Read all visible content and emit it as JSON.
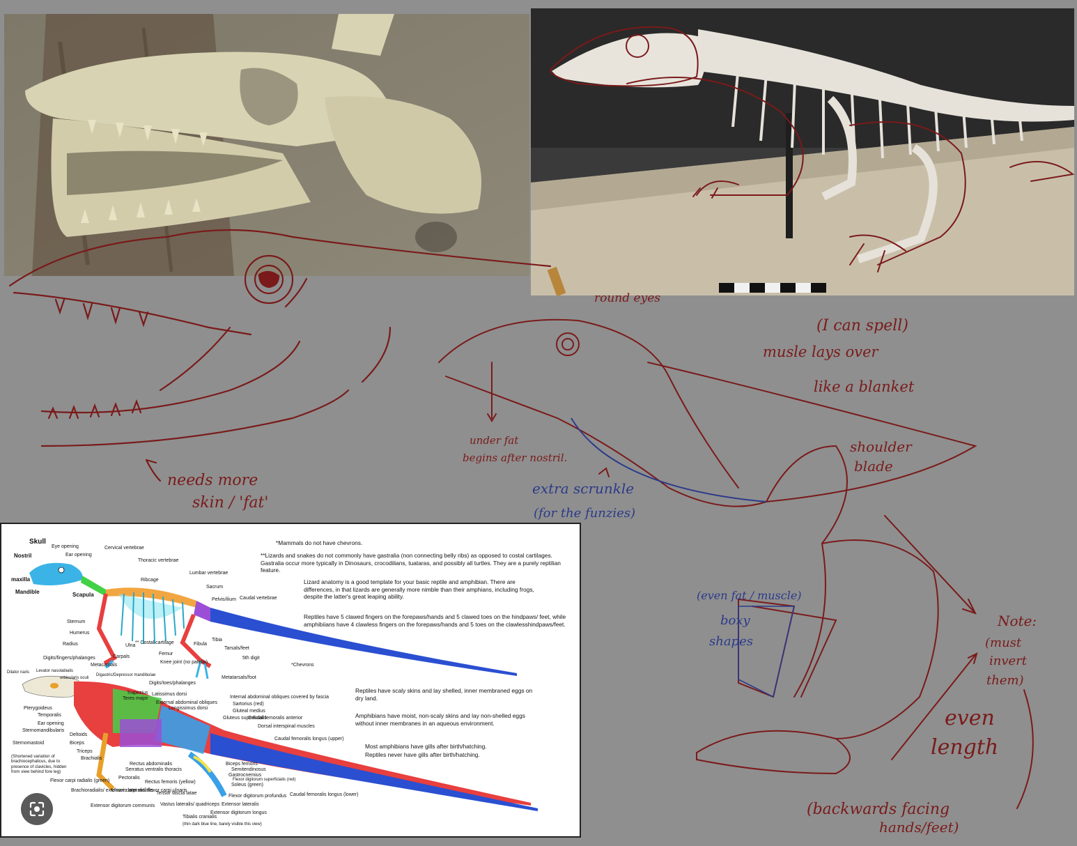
{
  "handwritten_notes": {
    "round_eyes": "round eyes",
    "i_can_spell": "(I can spell)",
    "muscle_line1": "musle lays over",
    "muscle_line2": "like a blanket",
    "under_fat_line1": "under fat",
    "under_fat_line2": "begins after nostril.",
    "shoulder_line1": "shoulder",
    "shoulder_line2": "blade",
    "extra_line1": "extra scrunkle",
    "extra_line2": "(for the funzies)",
    "needs_line1": "needs more",
    "needs_line2": "skin / 'fat'",
    "even_fat": "(even fat / muscle)",
    "boxy_line1": "boxy",
    "boxy_line2": "shapes",
    "note_line1": "Note:",
    "note_line2": "(must",
    "note_line3": "invert",
    "note_line4": "them)",
    "even_length_line1": "even",
    "even_length_line2": "length",
    "backwards_line1": "(backwards facing",
    "backwards_line2": "hands/feet)"
  },
  "diagram": {
    "skeleton_labels": {
      "skull": "Skull",
      "eye_opening": "Eye opening",
      "ear_opening": "Ear opening",
      "nostril": "Nostril",
      "maxilla": "maxilla",
      "mandible": "Mandible",
      "cervical": "Cervical vertebrae",
      "thoracic": "Thoracic vertebrae",
      "ribcage": "Ribcage",
      "lumbar": "Lumbar vertebrae",
      "sacrum": "Sacrum",
      "pelvis": "Pelvis/ilium",
      "caudal": "Caudal vertebrae",
      "scapula": "Scapula",
      "sternum": "Sternum",
      "humerus": "Humerus",
      "radius": "Radius",
      "ulna": "Ulna",
      "costal": "** Costal cartilage",
      "femur": "Femur",
      "fibula": "Fibula",
      "tibia": "Tibia",
      "tarsals": "Tarsals/feet",
      "fifth_digit": "5th digit",
      "metatarsals": "Metatarsals/foot",
      "carpals": "Carpals",
      "metacarpals": "Metacarpals",
      "digits_fingers": "Digits/fingers/phalanges",
      "digits_toes": "Digits/toes/phalanges",
      "knee": "Knee joint (no patella)",
      "chevrons": "*Chevrons"
    },
    "muscle_labels": {
      "dilator": "Dilator naris",
      "levator": "Levator nasolabialis",
      "orbicularis": "orbicularis oculi",
      "digastric": "Digastric/Depressor mandibulae",
      "pterygoideus": "Pterygoideus",
      "temporalis": "Temporalis",
      "ear_opening": "Ear opening",
      "sternomandibularis": "Sternomandibularis",
      "sternomastoid": "Sternomastoid",
      "sternomastoid_note": "(Shortened variation of brachiocephalicus, due to presence of clavicles, hidden from view behind fore leg)",
      "deltoids": "Deltoids",
      "biceps": "Biceps",
      "triceps": "Triceps",
      "brachialis": "Brachialis",
      "trapezius": "Trapezius",
      "teres": "Teres major",
      "latissimus": "Latissimus dorsi",
      "ext_obliques": "External abdominal obliques",
      "longissimus": "Longissimus dorsi",
      "int_obliques": "Internal abdominal obliques covered by fascia",
      "sartorius": "Sartorius (red)",
      "gluteal": "Gluteal medius",
      "gluteus_sup": "Gluteus superficialis",
      "caudal_ant": "Caudal femoralis anterior",
      "dorsal_inter": "Dorsal interspinal muscles",
      "caudal_long_upper": "Caudal femoralis longus (upper)",
      "caudal_long_lower": "Caudal femoralis longus (lower)",
      "rectus": "Rectus abdominalis",
      "serratus": "Serratus ventralis thoracis",
      "pectoralis": "Pectoralis",
      "flexor_carpi": "Flexor carpi radialis (green)",
      "brachioradialis": "Brachioradialis/ extensor carpi radialis",
      "ulnaris": "Ulnaris lateralis/ flexor carpi ulnaris",
      "ext_digitorum_comm": "Extensor digitorum communis",
      "rectus_fem": "Rectus femoris (yellow)",
      "tensor": "Tensor fascia latae",
      "vastus": "Vastus lateralis/ quadriceps",
      "tibialis": "Tibialis cranialis",
      "tibialis_note": "(thin dark blue line, barely visible this view)",
      "biceps_fem": "Biceps femoris",
      "semitendinosus": "Semitendinosus",
      "gastrocnemius": "Gastrocnemius",
      "flexor_sup": "Flexor digitorum superficialis (red)",
      "soleus": "Soleus (green)",
      "flexor_prof": "Flexor digitorum profundus",
      "ext_lateralis": "Extensor lateralis",
      "ext_digitorum_long": "Extensor digitorum longus"
    },
    "notes": {
      "mammals": "*Mammals do not have chevrons.",
      "gastralia": "**Lizards and snakes do not commonly have gastralia (non connecting belly ribs) as opposed to costal cartilages. Gastralia occur more typically in Dinosaurs, crocodilians, tuataras, and possibly all turtles. They are a purely reptilian feature.",
      "template": "Lizard anatomy is a good template for your basic reptile and amphibian. There are differences, in that lizards are generally more nimble than their amphians, including frogs, despite the latter's great leaping ability.",
      "claws": "Reptiles have 5 clawed fingers on the forepaws/hands and 5 clawed toes on the hindpaws/ feet, while amphibiians have 4 clawless fingers on the forepaws/hands and 5 toes on the clawlesshindpaws/feet.",
      "scaly": "Reptiles have scaly skins and lay shelled, inner membraned eggs on dry land.",
      "moist": "Amphibians have moist, non-scaly skins and lay non-shelled eggs without inner membranes in an aqueous environment.",
      "gills1": "Most amphibians have gills after birth/hatching.",
      "gills2": "Reptiles never have gills after birth/hatching."
    },
    "colors": {
      "skull": "#3bb3e6",
      "spine": "#f2a641",
      "tail": "#2b4fd1",
      "ribs": "#8ee6f2",
      "muscle_red": "#e83f3f",
      "muscle_green": "#43d146",
      "muscle_blue": "#3aa0e8",
      "muscle_purple": "#9b4fd6"
    }
  },
  "colors": {
    "background": "#8f8f8f",
    "sketch_red": "#7a1a1a",
    "sketch_blue": "#2b3a8a"
  },
  "icons": {
    "lens": "google-lens-icon"
  }
}
